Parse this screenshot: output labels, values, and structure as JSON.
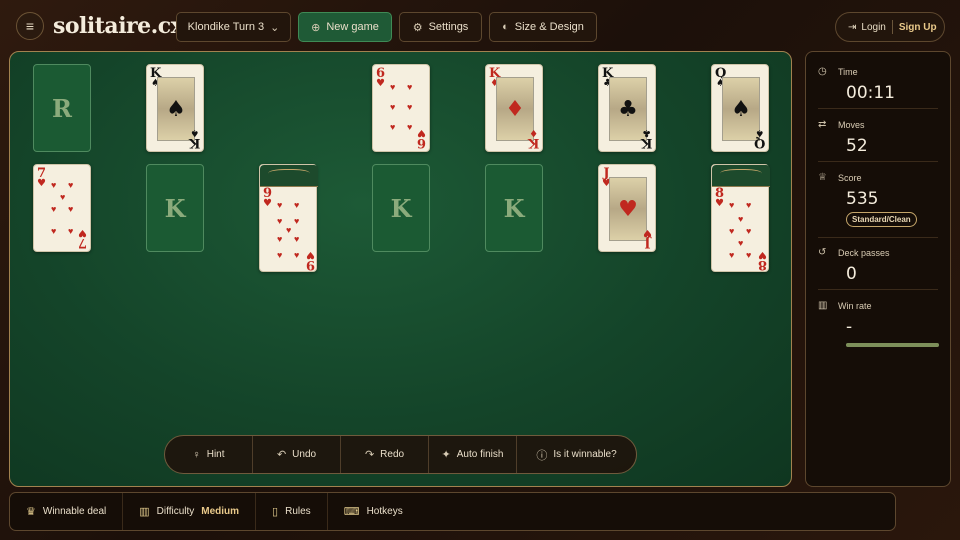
{
  "header": {
    "logo": "solitaire.cx",
    "game_mode": "Klondike Turn 3",
    "new_game": "New game",
    "settings": "Settings",
    "size_design": "Size & Design",
    "login": "Login",
    "signup": "Sign Up"
  },
  "foundations": [
    {
      "type": "empty",
      "label": "R"
    },
    {
      "type": "card",
      "rank": "K",
      "suit": "♠",
      "color": "black"
    },
    {
      "type": "card",
      "rank": "6",
      "suit": "♥",
      "color": "red"
    },
    {
      "type": "card",
      "rank": "K",
      "suit": "♦",
      "color": "red"
    },
    {
      "type": "card",
      "rank": "K",
      "suit": "♣",
      "color": "black"
    },
    {
      "type": "card",
      "rank": "Q",
      "suit": "♠",
      "color": "black"
    }
  ],
  "tableau": [
    {
      "type": "card",
      "rank": "7",
      "suit": "♥",
      "color": "red"
    },
    {
      "type": "empty",
      "label": "K"
    },
    {
      "type": "card",
      "rank": "9",
      "suit": "♥",
      "color": "red",
      "face_down_above": 1
    },
    {
      "type": "empty",
      "label": "K"
    },
    {
      "type": "empty",
      "label": "K"
    },
    {
      "type": "card",
      "rank": "J",
      "suit": "♥",
      "color": "red"
    },
    {
      "type": "card",
      "rank": "8",
      "suit": "♥",
      "color": "red",
      "face_down_above": 1
    }
  ],
  "controls": {
    "hint": "Hint",
    "undo": "Undo",
    "redo": "Redo",
    "auto_finish": "Auto finish",
    "winnable": "Is it winnable?"
  },
  "stats": {
    "time_label": "Time",
    "time": "00:11",
    "moves_label": "Moves",
    "moves": "52",
    "score_label": "Score",
    "score": "535",
    "score_mode": "Standard/Clean",
    "passes_label": "Deck passes",
    "passes": "0",
    "winrate_label": "Win rate",
    "winrate": "-"
  },
  "footer": {
    "winnable_deal": "Winnable deal",
    "difficulty_label": "Difficulty",
    "difficulty_value": "Medium",
    "rules": "Rules",
    "hotkeys": "Hotkeys"
  },
  "colors": {
    "felt": "#144429",
    "accent_gold": "#e9c98a",
    "card_red": "#c0281f",
    "new_game_green": "#1f5a36"
  }
}
